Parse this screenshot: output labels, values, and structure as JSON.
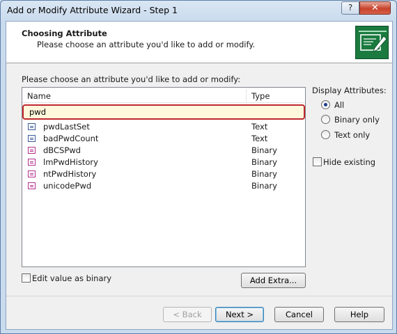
{
  "window": {
    "title": "Add or Modify Attribute Wizard - Step 1",
    "help_button": "?",
    "close_button": "✕"
  },
  "header": {
    "title": "Choosing Attribute",
    "subtitle": "Please choose an attribute you'd like to add or modify."
  },
  "main": {
    "prompt": "Please choose an attribute you'd like to add or modify:",
    "columns": {
      "name": "Name",
      "type": "Type"
    },
    "search_value": "pwd",
    "attributes": [
      {
        "name": "pwdLastSet",
        "type": "Text",
        "icon": "text-attribute-icon"
      },
      {
        "name": "badPwdCount",
        "type": "Text",
        "icon": "text-attribute-icon"
      },
      {
        "name": "dBCSPwd",
        "type": "Binary",
        "icon": "binary-attribute-icon"
      },
      {
        "name": "lmPwdHistory",
        "type": "Binary",
        "icon": "binary-attribute-icon"
      },
      {
        "name": "ntPwdHistory",
        "type": "Binary",
        "icon": "binary-attribute-icon"
      },
      {
        "name": "unicodePwd",
        "type": "Binary",
        "icon": "binary-attribute-icon"
      }
    ]
  },
  "display_attributes": {
    "label": "Display Attributes:",
    "options": [
      {
        "label": "All",
        "checked": true
      },
      {
        "label": "Binary only",
        "checked": false
      },
      {
        "label": "Text only",
        "checked": false
      }
    ],
    "hide_existing": "Hide existing"
  },
  "edit_binary": "Edit value as binary",
  "add_extra": "Add Extra...",
  "buttons": {
    "back": "< Back",
    "next": "Next >",
    "cancel": "Cancel",
    "help": "Help"
  },
  "colors": {
    "search_highlight": "#c0272d",
    "header_icon": "#1b7a3f"
  }
}
